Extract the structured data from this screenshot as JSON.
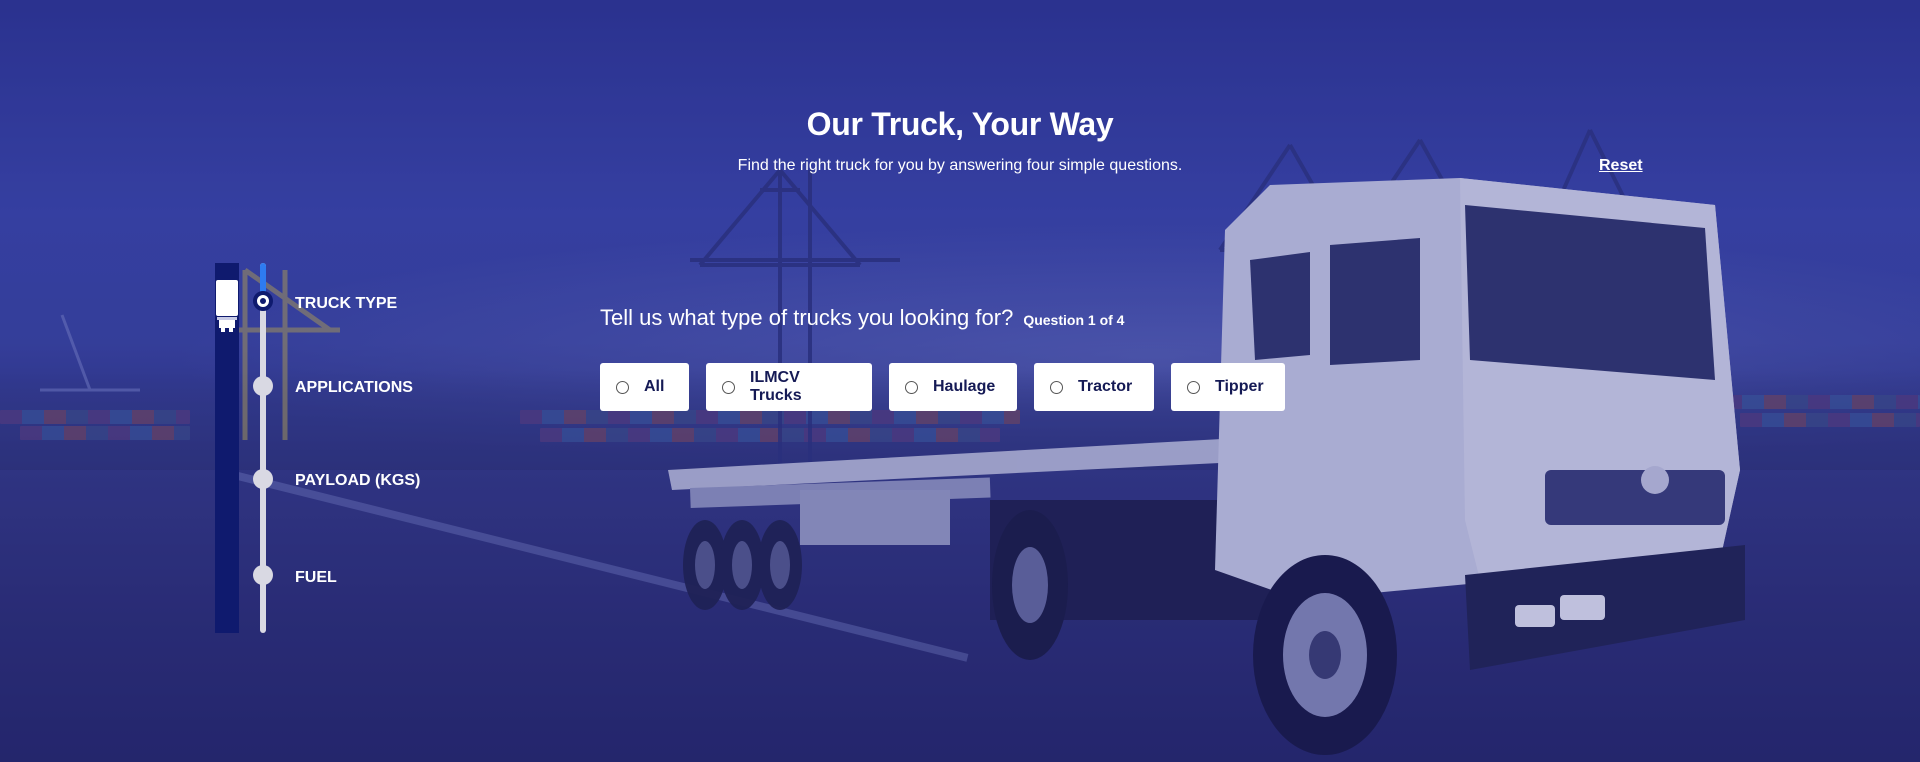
{
  "header": {
    "title": "Our Truck, Your Way",
    "subtitle": "Find the right truck for you by answering four simple questions.",
    "reset_label": "Reset"
  },
  "stepper": {
    "current_step": 1,
    "steps": [
      {
        "label": "TRUCK TYPE",
        "active": true
      },
      {
        "label": "APPLICATIONS",
        "active": false
      },
      {
        "label": "PAYLOAD (KGS)",
        "active": false
      },
      {
        "label": "FUEL",
        "active": false
      }
    ]
  },
  "question": {
    "text": "Tell us what type of trucks you looking for?",
    "counter": "Question 1 of 4",
    "options": [
      {
        "label": "All",
        "selected": false
      },
      {
        "label": "ILMCV Trucks",
        "selected": false
      },
      {
        "label": "Haulage",
        "selected": false
      },
      {
        "label": "Tractor",
        "selected": false
      },
      {
        "label": "Tipper",
        "selected": false
      }
    ]
  },
  "colors": {
    "overlay": "#2c3490",
    "stepper_bar": "#0f1a6e",
    "progress": "#2e7bf0",
    "option_text": "#151a55"
  },
  "icons": {
    "stepper_marker": "truck-icon",
    "option_control": "radio-icon"
  }
}
